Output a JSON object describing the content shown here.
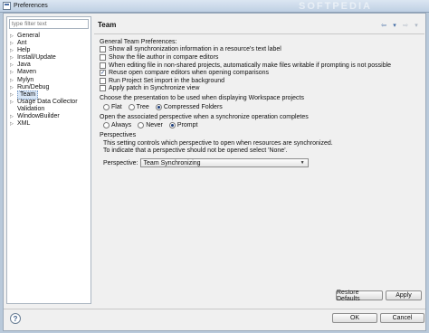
{
  "window": {
    "title": "Preferences",
    "watermark": "SOFTPEDIA"
  },
  "sidebar": {
    "filter_placeholder": "type filter text",
    "items": [
      {
        "label": "General",
        "expandable": true
      },
      {
        "label": "Ant",
        "expandable": true
      },
      {
        "label": "Help",
        "expandable": true
      },
      {
        "label": "Install/Update",
        "expandable": true
      },
      {
        "label": "Java",
        "expandable": true
      },
      {
        "label": "Maven",
        "expandable": true
      },
      {
        "label": "Mylyn",
        "expandable": true
      },
      {
        "label": "Run/Debug",
        "expandable": true
      },
      {
        "label": "Team",
        "expandable": true,
        "selected": true
      },
      {
        "label": "Usage Data Collector",
        "expandable": true
      },
      {
        "label": "Validation",
        "expandable": false
      },
      {
        "label": "WindowBuilder",
        "expandable": true
      },
      {
        "label": "XML",
        "expandable": true
      }
    ]
  },
  "page": {
    "title": "Team",
    "general_label": "General Team Preferences:",
    "options": [
      {
        "label": "Show all synchronization information in a resource's text label",
        "checked": false
      },
      {
        "label": "Show the file author in compare editors",
        "checked": false
      },
      {
        "label": "When editing file in non-shared projects, automatically make files writable if prompting is not possible",
        "checked": false
      },
      {
        "label": "Reuse open compare editors when opening comparisons",
        "checked": true
      },
      {
        "label": "Run Project Set import in the background",
        "checked": false
      },
      {
        "label": "Apply patch in Synchronize view",
        "checked": false
      }
    ],
    "presentation": {
      "label": "Choose the presentation to be used when displaying Workspace projects",
      "options": [
        {
          "label": "Flat",
          "selected": false
        },
        {
          "label": "Tree",
          "selected": false
        },
        {
          "label": "Compressed Folders",
          "selected": true
        }
      ]
    },
    "open_perspective": {
      "label": "Open the associated perspective when a synchronize operation completes",
      "options": [
        {
          "label": "Always",
          "selected": false
        },
        {
          "label": "Never",
          "selected": false
        },
        {
          "label": "Prompt",
          "selected": true
        }
      ]
    },
    "perspectives": {
      "title": "Perspectives",
      "description_1": "This setting controls which perspective to open when resources are synchronized.",
      "description_2": "To indicate that a perspective should not be opened select 'None'.",
      "select_label": "Perspective:",
      "select_value": "Team Synchronizing"
    }
  },
  "buttons": {
    "restore_defaults": "Restore Defaults",
    "apply": "Apply",
    "ok": "OK",
    "cancel": "Cancel"
  }
}
